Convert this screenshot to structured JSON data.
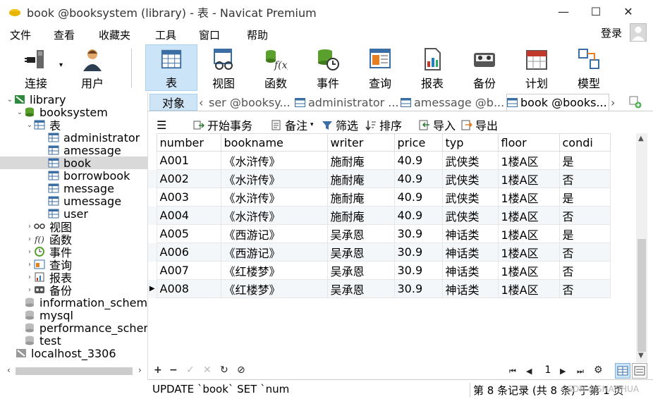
{
  "window": {
    "title": "book @booksystem (library) - 表 - Navicat Premium",
    "minimize_glyph": "—",
    "maximize_glyph": "☐",
    "close_glyph": "✕"
  },
  "menu": [
    "文件",
    "查看",
    "收藏夹",
    "工具",
    "窗口",
    "帮助"
  ],
  "login_label": "登录",
  "toolbar": [
    {
      "label": "连接",
      "icon": "plug-icon"
    },
    {
      "label": "用户",
      "icon": "user-icon"
    },
    {
      "label": "表",
      "icon": "table-icon",
      "active": true
    },
    {
      "label": "视图",
      "icon": "view-glasses-icon"
    },
    {
      "label": "函数",
      "icon": "function-icon"
    },
    {
      "label": "事件",
      "icon": "event-clock-icon"
    },
    {
      "label": "查询",
      "icon": "query-icon"
    },
    {
      "label": "报表",
      "icon": "report-icon"
    },
    {
      "label": "备份",
      "icon": "backup-icon"
    },
    {
      "label": "计划",
      "icon": "calendar-icon"
    },
    {
      "label": "模型",
      "icon": "model-icon"
    }
  ],
  "tree": [
    {
      "label": "library",
      "level": 0,
      "expanded": true,
      "icon": "connection-icon"
    },
    {
      "label": "booksystem",
      "level": 1,
      "expanded": true,
      "icon": "database-icon"
    },
    {
      "label": "表",
      "level": 2,
      "expanded": true,
      "icon": "tables-folder-icon"
    },
    {
      "label": "administrator",
      "level": 3,
      "icon": "table-icon"
    },
    {
      "label": "amessage",
      "level": 3,
      "icon": "table-icon"
    },
    {
      "label": "book",
      "level": 3,
      "icon": "table-icon",
      "selected": true
    },
    {
      "label": "borrowbook",
      "level": 3,
      "icon": "table-icon"
    },
    {
      "label": "message",
      "level": 3,
      "icon": "table-icon"
    },
    {
      "label": "umessage",
      "level": 3,
      "icon": "table-icon"
    },
    {
      "label": "user",
      "level": 3,
      "icon": "table-icon"
    },
    {
      "label": "视图",
      "level": 2,
      "collapsed": true,
      "icon": "view-glasses-icon"
    },
    {
      "label": "函数",
      "level": 2,
      "collapsed": true,
      "icon": "function-icon"
    },
    {
      "label": "事件",
      "level": 2,
      "collapsed": true,
      "icon": "event-clock-icon"
    },
    {
      "label": "查询",
      "level": 2,
      "collapsed": true,
      "icon": "query-icon"
    },
    {
      "label": "报表",
      "level": 2,
      "collapsed": true,
      "icon": "report-icon"
    },
    {
      "label": "备份",
      "level": 2,
      "collapsed": true,
      "icon": "backup-icon"
    },
    {
      "label": "information_schem",
      "level": 1,
      "icon": "database-gray-icon"
    },
    {
      "label": "mysql",
      "level": 1,
      "icon": "database-gray-icon"
    },
    {
      "label": "performance_scher",
      "level": 1,
      "icon": "database-gray-icon"
    },
    {
      "label": "test",
      "level": 1,
      "icon": "database-gray-icon"
    },
    {
      "label": "localhost_3306",
      "level": 0,
      "icon": "connection-gray-icon"
    }
  ],
  "tabs": {
    "objects": "对象",
    "items": [
      {
        "label": "ser @booksy...",
        "icon": "table-icon"
      },
      {
        "label": "administrator ...",
        "icon": "table-icon"
      },
      {
        "label": "amessage @b...",
        "icon": "table-icon"
      },
      {
        "label": "book @books...",
        "icon": "table-icon",
        "active": true
      }
    ],
    "prev_glyph": "‹",
    "next_glyph": "›"
  },
  "grid_toolbar": {
    "menu_glyph": "☰",
    "begin_transaction": "开始事务",
    "memo": "备注",
    "filter": "筛选",
    "sort": "排序",
    "import": "导入",
    "export": "导出"
  },
  "grid": {
    "columns": [
      "number",
      "bookname",
      "writer",
      "price",
      "typ",
      "floor",
      "condi"
    ],
    "rows": [
      [
        "A001",
        "《水浒传》",
        "施耐庵",
        "40.9",
        "武侠类",
        "1楼A区",
        "是"
      ],
      [
        "A002",
        "《水浒传》",
        "施耐庵",
        "40.9",
        "武侠类",
        "1楼A区",
        "否"
      ],
      [
        "A003",
        "《水浒传》",
        "施耐庵",
        "40.9",
        "武侠类",
        "1楼A区",
        "是"
      ],
      [
        "A004",
        "《水浒传》",
        "施耐庵",
        "40.9",
        "武侠类",
        "1楼A区",
        "否"
      ],
      [
        "A005",
        "《西游记》",
        "吴承恩",
        "30.9",
        "神话类",
        "1楼A区",
        "是"
      ],
      [
        "A006",
        "《西游记》",
        "吴承恩",
        "30.9",
        "神话类",
        "1楼A区",
        "否"
      ],
      [
        "A007",
        "《红楼梦》",
        "吴承恩",
        "30.9",
        "神话类",
        "1楼A区",
        "否"
      ],
      [
        "A008",
        "《红楼梦》",
        "吴承恩",
        "30.9",
        "神话类",
        "1楼A区",
        "否"
      ]
    ],
    "current_row_index": 7
  },
  "record_nav": {
    "add": "+",
    "delete": "−",
    "apply": "✓",
    "cancel": "✕",
    "refresh": "↻",
    "stop": "⊘",
    "first": "⏮",
    "prev": "◀",
    "page": "1",
    "next": "▶",
    "last": "⏭",
    "settings": "⚙"
  },
  "status": {
    "sql": "UPDATE `book` SET `num",
    "record_info": "第 8 条记录 (共 8 条) 于第 1 页",
    "watermark": "CSDN @SHAOHUA"
  }
}
